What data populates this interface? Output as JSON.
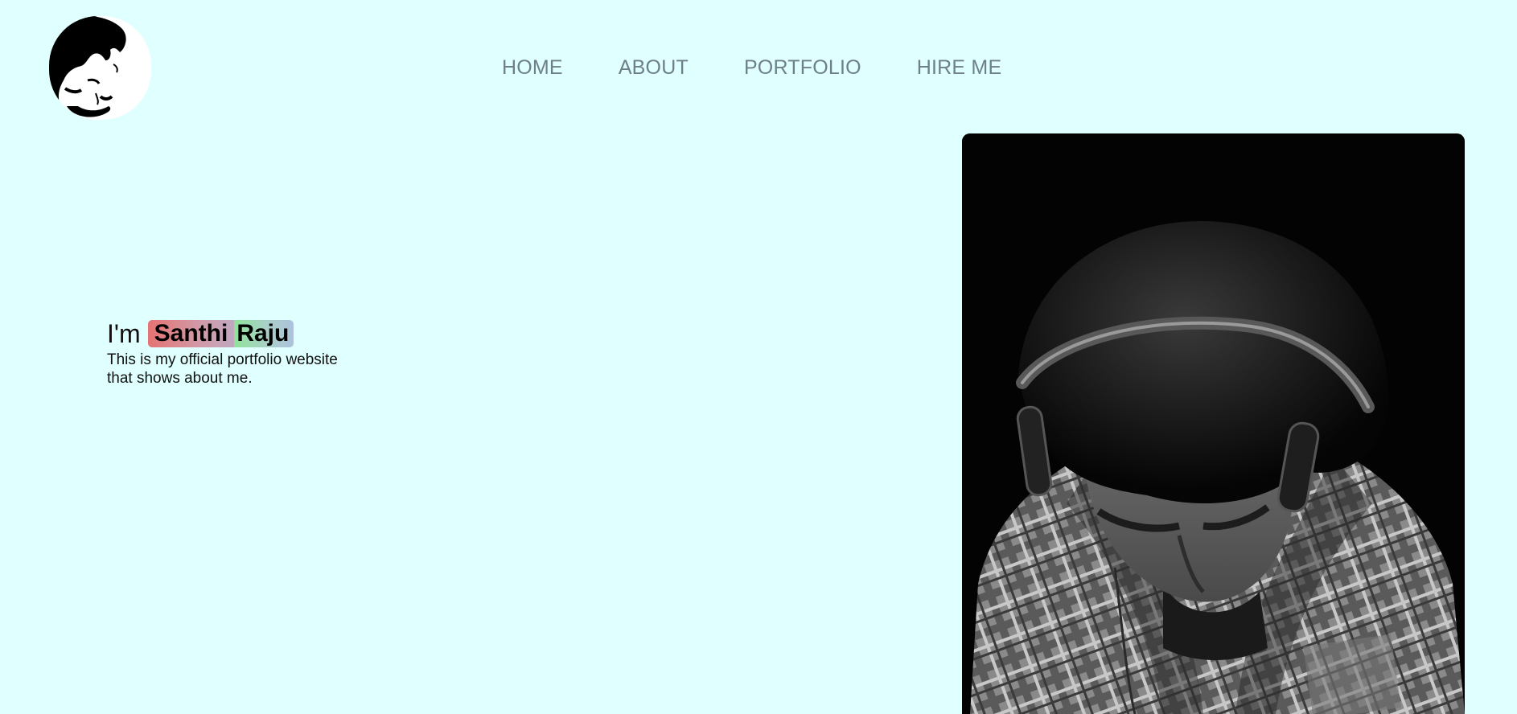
{
  "header": {
    "logo_icon": "avatar-logo-icon"
  },
  "nav": {
    "items": [
      {
        "label": "HOME"
      },
      {
        "label": "ABOUT"
      },
      {
        "label": "PORTFOLIO"
      },
      {
        "label": "HIRE ME"
      }
    ],
    "color": "#6e7f8a"
  },
  "hero": {
    "greeting_prefix": "I'm",
    "first_name": "Santhi",
    "last_name": "Raju",
    "tagline": "This is my official portfolio website that shows about me."
  },
  "photo": {
    "icon": "portrait-photo"
  },
  "theme": {
    "background": "#e0ffff",
    "first_name_gradient": [
      "#e57373",
      "#c0a8c0"
    ],
    "last_name_gradient": [
      "#8fe39a",
      "#adc2dc"
    ]
  }
}
